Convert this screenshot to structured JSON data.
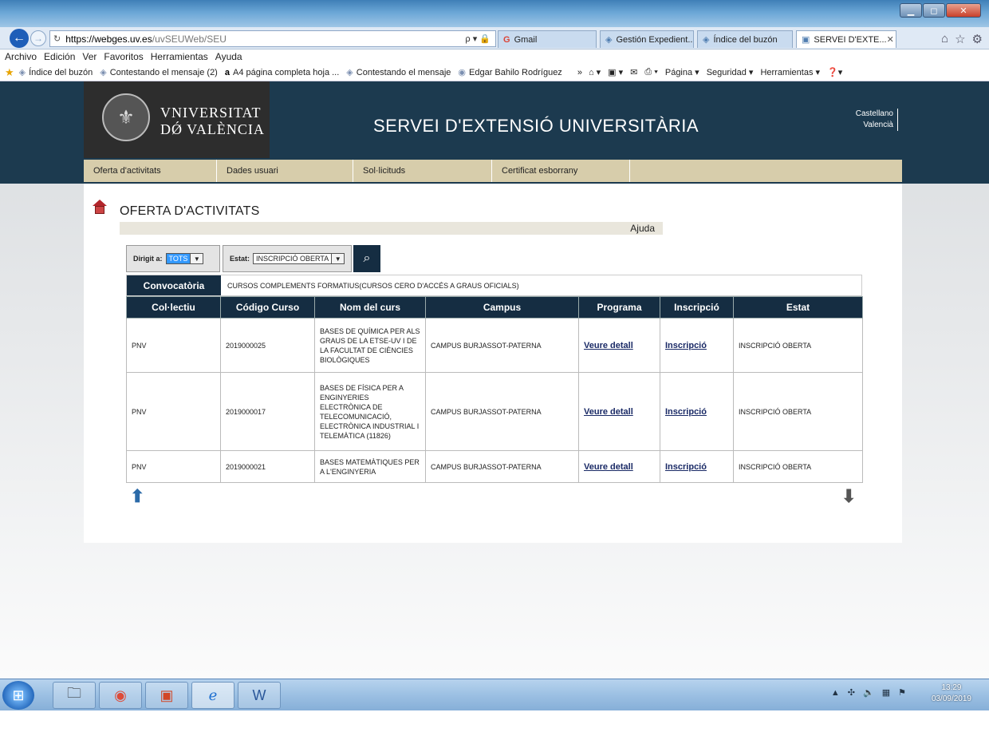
{
  "browser": {
    "address": {
      "host": "https://webges.uv.es",
      "path": "/uvSEUWeb/SEU",
      "tools": "ρ ▾ 🔒"
    },
    "tabs": [
      {
        "label": "Gmail"
      },
      {
        "label": "Gestión Expedient..."
      },
      {
        "label": "Índice del buzón"
      },
      {
        "label": "SERVEI D'EXTE...",
        "active": true
      }
    ],
    "menu": [
      "Archivo",
      "Edición",
      "Ver",
      "Favoritos",
      "Herramientas",
      "Ayuda"
    ],
    "favorites": [
      "Índice del buzón",
      "Contestando el mensaje (2)",
      "A4 página completa hoja ...",
      "Contestando el mensaje",
      "Edgar Bahilo Rodríguez"
    ],
    "commands": [
      "Página ▾",
      "Seguridad ▾",
      "Herramientas ▾"
    ]
  },
  "site": {
    "logo_line1": "VNIVERSITAT",
    "logo_line2": "DǾ VALÈNCIA",
    "title": "SERVEI D'EXTENSIÓ UNIVERSITÀRIA",
    "languages": [
      "Castellano",
      "Valencià"
    ],
    "nav": [
      "Oferta d'activitats",
      "Dades usuari",
      "Sol·licituds",
      "Certificat esborrany"
    ]
  },
  "page": {
    "title": "OFERTA D'ACTIVITATS",
    "help": "Ajuda",
    "filters": {
      "dirigit_label": "Dirigit a:",
      "dirigit_value": "TOTS",
      "estat_label": "Estat:",
      "estat_value": "INSCRIPCIÓ OBERTA"
    },
    "convocatoria_label": "Convocatòria",
    "convocatoria_value": "CURSOS COMPLEMENTS FORMATIUS(CURSOS CERO D'ACCÉS A GRAUS OFICIALS)",
    "columns": [
      "Col·lectiu",
      "Código Curso",
      "Nom del curs",
      "Campus",
      "Programa",
      "Inscripció",
      "Estat"
    ],
    "rows": [
      {
        "col": "PNV",
        "code": "2019000025",
        "name": "BASES DE QUÍMICA PER ALS GRAUS DE LA ETSE-UV I DE LA FACULTAT DE CIÈNCIES BIOLÒGIQUES",
        "campus": "CAMPUS BURJASSOT-PATERNA",
        "programa": "Veure detall",
        "inscripcio": "Inscripció",
        "estat": "INSCRIPCIÓ OBERTA"
      },
      {
        "col": "PNV",
        "code": "2019000017",
        "name": "BASES DE FÍSICA PER A ENGINYERIES ELECTRÒNICA DE TELECOMUNICACIÓ, ELECTRÒNICA INDUSTRIAL I TELEMÀTICA (11826)",
        "campus": "CAMPUS BURJASSOT-PATERNA",
        "programa": "Veure detall",
        "inscripcio": "Inscripció",
        "estat": "INSCRIPCIÓ OBERTA"
      },
      {
        "col": "PNV",
        "code": "2019000021",
        "name": "BASES MATEMÀTIQUES PER A L'ENGINYERIA",
        "campus": "CAMPUS BURJASSOT-PATERNA",
        "programa": "Veure detall",
        "inscripcio": "Inscripció",
        "estat": "INSCRIPCIÓ OBERTA"
      }
    ]
  },
  "taskbar": {
    "time": "13:29",
    "date": "03/09/2019"
  }
}
